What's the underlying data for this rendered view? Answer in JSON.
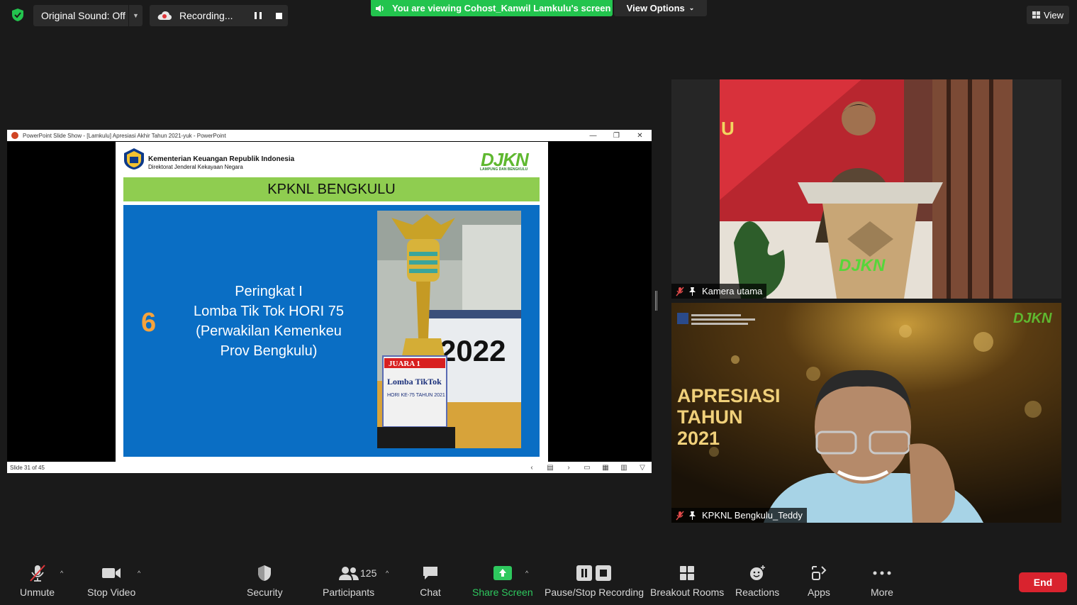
{
  "topbar": {
    "original_sound": "Original Sound: Off",
    "recording": "Recording...",
    "viewing_banner": "You are viewing Cohost_Kanwil Lamkulu's screen",
    "view_options": "View Options",
    "view": "View"
  },
  "ppt": {
    "window_title": "PowerPoint Slide Show - [Lamkulu] Apresiasi Akhir Tahun 2021-yuk - PowerPoint",
    "status": "Slide 31 of 45",
    "slide": {
      "org_line1": "Kementerian Keuangan Republik Indonesia",
      "org_line2": "Direktorat Jenderal Kekayaan Negara",
      "logo_text": "DJKN",
      "logo_sub": "LAMPUNG DAN BENGKULU",
      "heading": "KPKNL BENGKULU",
      "number": "6",
      "caption_l1": "Peringkat I",
      "caption_l2": "Lomba Tik Tok HORI 75",
      "caption_l3": "(Perwakilan Kemenkeu",
      "caption_l4": "Prov Bengkulu)",
      "photo_year": "2022",
      "plaque_l1": "JUARA 1",
      "plaque_l2": "Lomba TikTok",
      "plaque_l3": "HORI KE-75 TAHUN 2021"
    }
  },
  "tiles": [
    {
      "name": "Kamera  utama",
      "stage_text": "DJKN",
      "stage_left": "U"
    },
    {
      "name": "KPKNL Bengkulu_Teddy",
      "bg_l1": "APRESIASI",
      "bg_l2": "TAHUN",
      "bg_l3": "2021",
      "bg_logo": "DJKN"
    }
  ],
  "toolbar": {
    "unmute": "Unmute",
    "stop_video": "Stop Video",
    "security": "Security",
    "participants": "Participants",
    "participant_count": "125",
    "chat": "Chat",
    "share_screen": "Share Screen",
    "pause_stop_recording": "Pause/Stop Recording",
    "breakout_rooms": "Breakout Rooms",
    "reactions": "Reactions",
    "apps": "Apps",
    "more": "More",
    "end": "End"
  },
  "colors": {
    "share_green": "#23c44e",
    "end_red": "#d9232e",
    "slide_blue": "#0a6ec4",
    "band_green": "#8fcd50"
  }
}
